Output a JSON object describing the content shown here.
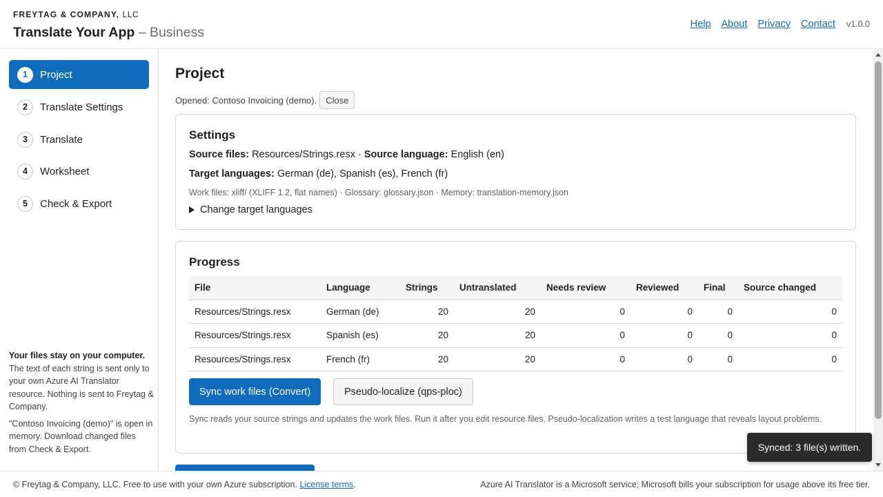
{
  "header": {
    "company": "FREYTAG & COMPANY,",
    "company_suffix": "LLC",
    "app_title": "Translate Your App",
    "app_edition": "– Business",
    "nav": [
      "Help",
      "About",
      "Privacy",
      "Contact"
    ],
    "version": "v1.0.0"
  },
  "sidebar": {
    "steps": [
      {
        "num": "1",
        "label": "Project",
        "active": true
      },
      {
        "num": "2",
        "label": "Translate Settings",
        "active": false
      },
      {
        "num": "3",
        "label": "Translate",
        "active": false
      },
      {
        "num": "4",
        "label": "Worksheet",
        "active": false
      },
      {
        "num": "5",
        "label": "Check & Export",
        "active": false
      }
    ],
    "note_title": "Your files stay on your computer.",
    "note_body": "The text of each string is sent only to your own Azure AI Translator resource. Nothing is sent to Freytag & Company.",
    "note_memory": "\"Contoso Invoicing (demo)\" is open in memory. Download changed files from Check & Export."
  },
  "main": {
    "title": "Project",
    "opened_text": "Opened: Contoso Invoicing (demo).",
    "close_label": "Close",
    "settings": {
      "heading": "Settings",
      "source_files_label": "Source files:",
      "source_files_value": "Resources/Strings.resx",
      "separator": "·",
      "source_language_label": "Source language:",
      "source_language_value": "English (en)",
      "target_languages_label": "Target languages:",
      "target_languages_value": "German (de), Spanish (es), French (fr)",
      "work_files_line": "Work files: xliff/ (XLIFF 1.2, flat names) · Glossary: glossary.json · Memory: translation-memory.json",
      "change_targets_label": "Change target languages"
    },
    "progress": {
      "heading": "Progress",
      "columns": [
        "File",
        "Language",
        "Strings",
        "Untranslated",
        "Needs review",
        "Reviewed",
        "Final",
        "Source changed"
      ],
      "rows": [
        [
          "Resources/Strings.resx",
          "German (de)",
          "20",
          "20",
          "0",
          "0",
          "0",
          "0"
        ],
        [
          "Resources/Strings.resx",
          "Spanish (es)",
          "20",
          "20",
          "0",
          "0",
          "0",
          "0"
        ],
        [
          "Resources/Strings.resx",
          "French (fr)",
          "20",
          "20",
          "0",
          "0",
          "0",
          "0"
        ]
      ],
      "sync_label": "Sync work files (Convert)",
      "pseudo_label": "Pseudo-localize (qps-ploc)",
      "note": "Sync reads your source strings and updates the work files. Run it after you edit resource files. Pseudo-localization writes a test language that reveals layout problems."
    }
  },
  "footer": {
    "left_text": "© Freytag & Company, LLC. Free to use with your own Azure subscription.",
    "license_link": "License terms",
    "left_end": ".",
    "right_text": "Azure AI Translator is a Microsoft service; Microsoft bills your subscription for usage above its free tier."
  },
  "toast": {
    "message": "Synced: 3 file(s) written."
  },
  "colors": {
    "accent": "#0f6cbd",
    "toast_bg": "#2b2b2b"
  }
}
